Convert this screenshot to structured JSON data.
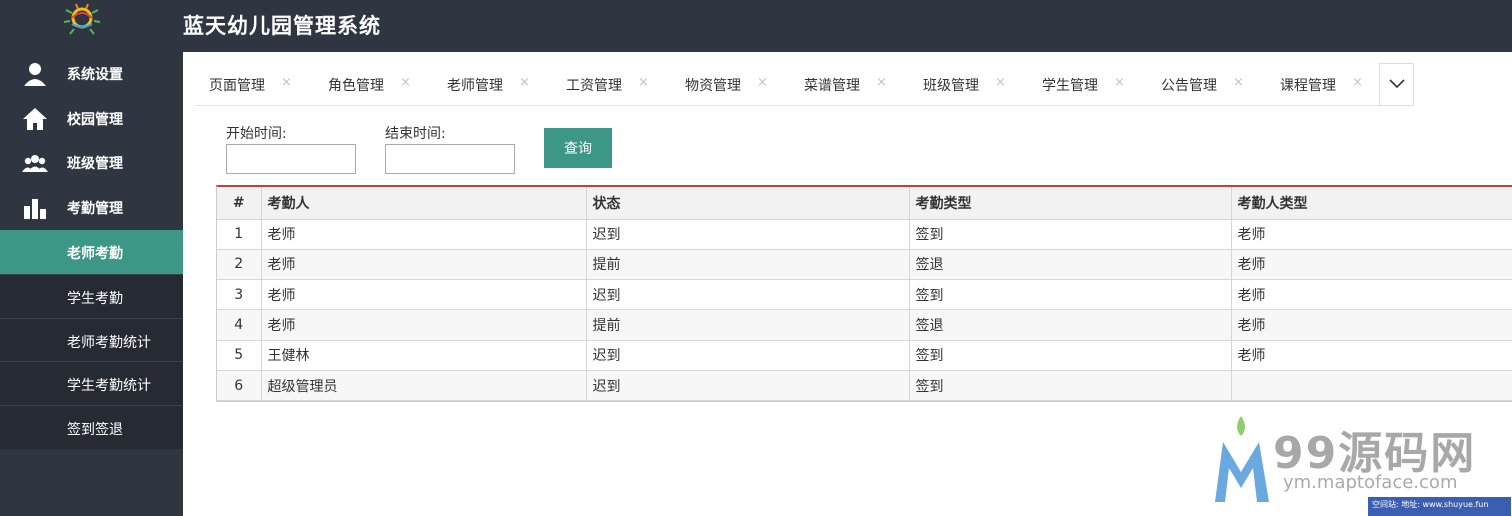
{
  "app": {
    "title": "蓝天幼儿园管理系统"
  },
  "sidebar": {
    "top_items": [
      {
        "label": "系统设置",
        "icon": "user-icon"
      },
      {
        "label": "校园管理",
        "icon": "home-icon"
      },
      {
        "label": "班级管理",
        "icon": "group-icon"
      },
      {
        "label": "考勤管理",
        "icon": "bar-chart-icon"
      }
    ],
    "sub_items": [
      {
        "label": "老师考勤",
        "active": true
      },
      {
        "label": "学生考勤"
      },
      {
        "label": "老师考勤统计"
      },
      {
        "label": "学生考勤统计"
      },
      {
        "label": "签到签退"
      }
    ]
  },
  "tabs": [
    {
      "label": "页面管理",
      "close": "×"
    },
    {
      "label": "角色管理",
      "close": "×"
    },
    {
      "label": "老师管理",
      "close": "×"
    },
    {
      "label": "工资管理",
      "close": "×"
    },
    {
      "label": "物资管理",
      "close": "×"
    },
    {
      "label": "菜谱管理",
      "close": "×"
    },
    {
      "label": "班级管理",
      "close": "×"
    },
    {
      "label": "学生管理",
      "close": "×"
    },
    {
      "label": "公告管理",
      "close": "×"
    },
    {
      "label": "课程管理",
      "close": "×"
    }
  ],
  "filter": {
    "start_label": "开始时间:",
    "end_label": "结束时间:",
    "start_value": "",
    "end_value": "",
    "query_label": "查询"
  },
  "table": {
    "columns": [
      "#",
      "考勤人",
      "状态",
      "考勤类型",
      "考勤人类型"
    ],
    "rows": [
      [
        "1",
        "老师",
        "迟到",
        "签到",
        "老师"
      ],
      [
        "2",
        "老师",
        "提前",
        "签退",
        "老师"
      ],
      [
        "3",
        "老师",
        "迟到",
        "签到",
        "老师"
      ],
      [
        "4",
        "老师",
        "提前",
        "签退",
        "老师"
      ],
      [
        "5",
        "王健林",
        "迟到",
        "签到",
        "老师"
      ],
      [
        "6",
        "超级管理员",
        "迟到",
        "签到",
        ""
      ]
    ]
  },
  "watermark": {
    "brand": "99源码网",
    "url": "ym.maptoface.com",
    "strip": "空间站: 地址: www.shuyue.fun"
  },
  "colors": {
    "header_bg": "#2f3541",
    "active": "#3d9786",
    "table_top_border": "#c4423a"
  }
}
